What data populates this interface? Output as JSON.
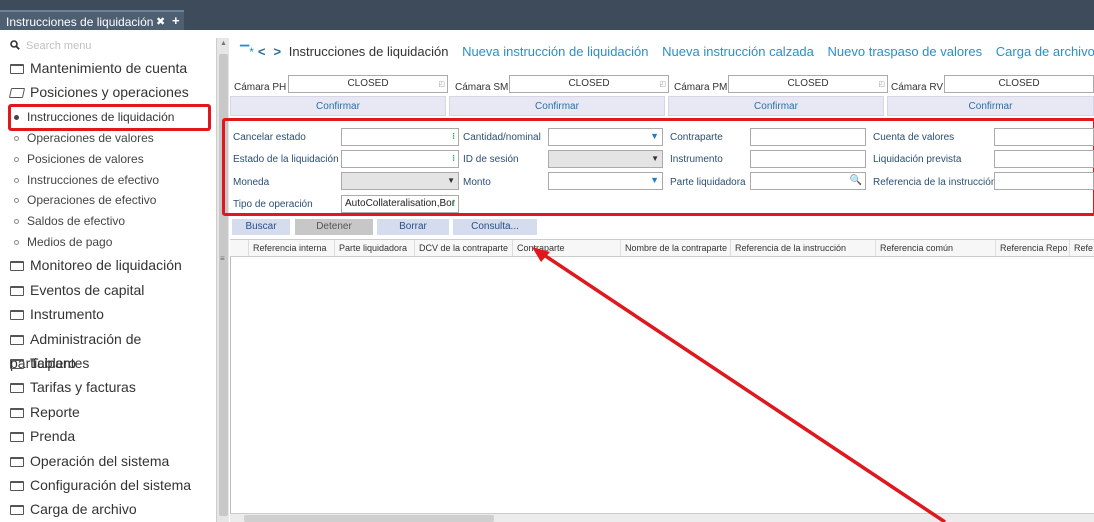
{
  "tabs": [
    {
      "label": "Instrucciones de liquidación"
    }
  ],
  "sidebar": {
    "search_placeholder": "Search menu",
    "items": [
      {
        "label": "Mantenimiento de cuenta",
        "type": "folder"
      },
      {
        "label": "Posiciones y operaciones",
        "type": "folder-open"
      },
      {
        "label": "Instrucciones de liquidación",
        "type": "sub",
        "active": true
      },
      {
        "label": "Operaciones de valores",
        "type": "sub"
      },
      {
        "label": "Posiciones de valores",
        "type": "sub"
      },
      {
        "label": "Instrucciones de efectivo",
        "type": "sub"
      },
      {
        "label": "Operaciones de efectivo",
        "type": "sub"
      },
      {
        "label": "Saldos de efectivo",
        "type": "sub"
      },
      {
        "label": "Medios de pago",
        "type": "sub"
      },
      {
        "label": "Monitoreo de liquidación",
        "type": "folder"
      },
      {
        "label": "Eventos de capital",
        "type": "folder"
      },
      {
        "label": "Instrumento",
        "type": "folder"
      },
      {
        "label": "Administración de participantes",
        "type": "folder"
      },
      {
        "label": "Tablero",
        "type": "folder"
      },
      {
        "label": "Tarifas y facturas",
        "type": "folder"
      },
      {
        "label": "Reporte",
        "type": "folder"
      },
      {
        "label": "Prenda",
        "type": "folder"
      },
      {
        "label": "Operación del sistema",
        "type": "folder"
      },
      {
        "label": "Configuración del sistema",
        "type": "folder"
      },
      {
        "label": "Carga de archivo",
        "type": "folder"
      }
    ]
  },
  "breadcrumb": {
    "current": "Instrucciones de liquidación",
    "links": [
      "Nueva instrucción de liquidación",
      "Nueva instrucción calzada",
      "Nuevo traspaso de valores",
      "Carga de archivo"
    ]
  },
  "camaras": [
    {
      "label": "Cámara PH",
      "value": "CLOSED",
      "confirm": "Confirmar"
    },
    {
      "label": "Cámara SM",
      "value": "CLOSED",
      "confirm": "Confirmar"
    },
    {
      "label": "Cámara PM",
      "value": "CLOSED",
      "confirm": "Confirmar"
    },
    {
      "label": "Cámara RV",
      "value": "CLOSED",
      "confirm": "Confirmar"
    }
  ],
  "filters": {
    "cancelar_estado": "Cancelar estado",
    "estado_liquidacion": "Estado de la liquidación",
    "moneda": "Moneda",
    "tipo_operacion": "Tipo de operación",
    "tipo_operacion_value": "AutoCollateralisation,Bor",
    "cantidad_nominal": "Cantidad/nominal",
    "id_sesion": "ID de sesión",
    "monto": "Monto",
    "contraparte": "Contraparte",
    "instrumento": "Instrumento",
    "parte_liquidadora": "Parte liquidadora",
    "cuenta_valores": "Cuenta de valores",
    "liquidacion_prevista": "Liquidación prevista",
    "referencia_instruccion": "Referencia de la instrucción"
  },
  "actions": {
    "buscar": "Buscar",
    "detener": "Detener",
    "borrar": "Borrar",
    "consulta": "Consulta..."
  },
  "table": {
    "columns": [
      "Referencia interna",
      "Parte liquidadora",
      "DCV de la contraparte",
      "Contraparte",
      "Nombre de la contraparte",
      "Referencia de la instrucción",
      "Referencia común",
      "Referencia Repo",
      "Refe"
    ]
  },
  "colors": {
    "highlight": "#e0171c",
    "link": "#2a8fc9",
    "header_bg": "#3d4b5b"
  }
}
